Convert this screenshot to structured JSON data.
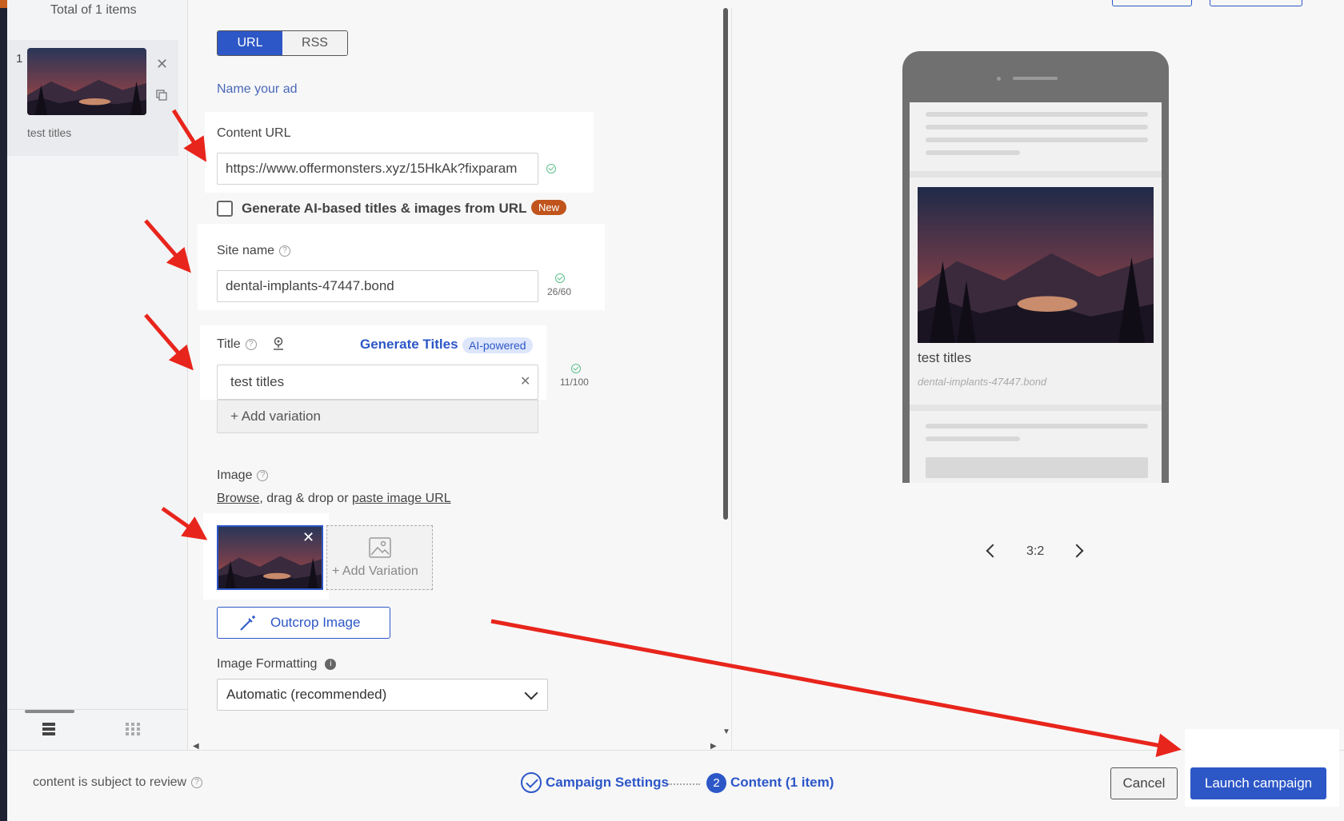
{
  "list": {
    "total": "Total of 1 items",
    "items": [
      {
        "num": "1",
        "title": "test titles"
      }
    ]
  },
  "form": {
    "toggle": {
      "url": "URL",
      "rss": "RSS"
    },
    "name_ad": "Name your ad",
    "content_url_label": "Content URL",
    "content_url_value": "https://www.offermonsters.xyz/15HkAk?fixparam",
    "ai_checkbox_label": "Generate AI-based titles & images from URL",
    "ai_badge": "New",
    "site_name_label": "Site name",
    "site_name_value": "dental-implants-47447.bond",
    "site_name_counter": "26/60",
    "title_label": "Title",
    "generate_titles": "Generate Titles",
    "ai_powered": "AI-powered",
    "title_value": "test titles",
    "title_counter": "11/100",
    "add_variation": "+ Add variation",
    "image_label": "Image",
    "browse": "Browse",
    "drag_drop": ", drag & drop or ",
    "paste_url": "paste image URL",
    "add_image_variation": "+ Add Variation",
    "outcrop": "Outcrop Image",
    "formatting_label": "Image Formatting",
    "formatting_value": "Automatic (recommended)"
  },
  "preview": {
    "title": "test titles",
    "site": "dental-implants-47447.bond",
    "ratio": "3:2"
  },
  "footer": {
    "review_note": "content is subject to review",
    "step1": "Campaign Settings",
    "step2_num": "2",
    "step2": "Content (1 item)",
    "cancel": "Cancel",
    "launch": "Launch campaign"
  },
  "colors": {
    "accent": "#2d57c7",
    "annotation": "#e8251c",
    "badge_new": "#c0541c"
  }
}
